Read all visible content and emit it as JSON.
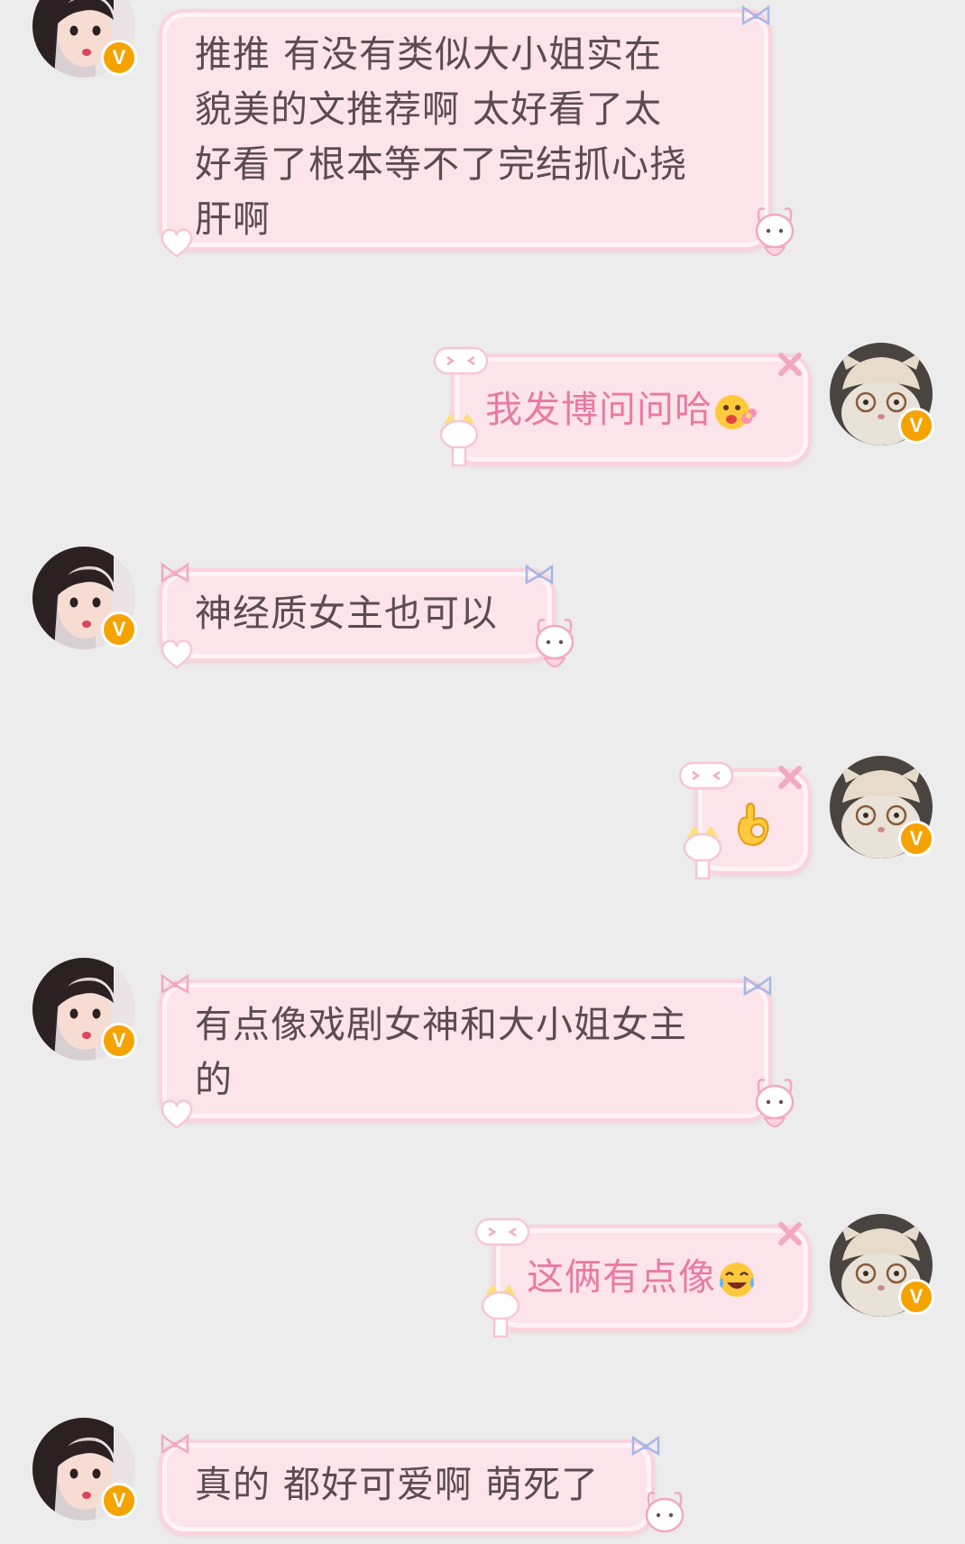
{
  "theme": {
    "background": "#ececec",
    "incoming_text_color": "#5d4a52",
    "outgoing_text_color": "#e97aa3",
    "bubble_fill": "#fce4ea",
    "bubble_border": "#fbd3de",
    "verified_badge_color": "#f5a300"
  },
  "messages": [
    {
      "sender": "other",
      "text": "推推 有没有类似大小姐实在\n貌美的文推荐啊 太好看了太\n好看了根本等不了完结抓心挠\n肝啊",
      "avatar_icon": "girl-avatar-icon",
      "badge": "V"
    },
    {
      "sender": "me",
      "text": "我发博问问哈",
      "emoji": "flower-face-emoji-icon",
      "avatar_icon": "cat-with-hat-avatar-icon",
      "badge": "V"
    },
    {
      "sender": "other",
      "text": "神经质女主也可以",
      "avatar_icon": "girl-avatar-icon",
      "badge": "V"
    },
    {
      "sender": "me",
      "text": "",
      "emoji": "ok-hand-emoji-icon",
      "avatar_icon": "cat-with-hat-avatar-icon",
      "badge": "V"
    },
    {
      "sender": "other",
      "text": "有点像戏剧女神和大小姐女主\n的",
      "avatar_icon": "girl-avatar-icon",
      "badge": "V"
    },
    {
      "sender": "me",
      "text": "这俩有点像",
      "emoji": "tears-of-joy-emoji-icon",
      "avatar_icon": "cat-with-hat-avatar-icon",
      "badge": "V"
    },
    {
      "sender": "other",
      "text": "真的 都好可爱啊 萌死了",
      "avatar_icon": "girl-avatar-icon",
      "badge": "V"
    }
  ]
}
